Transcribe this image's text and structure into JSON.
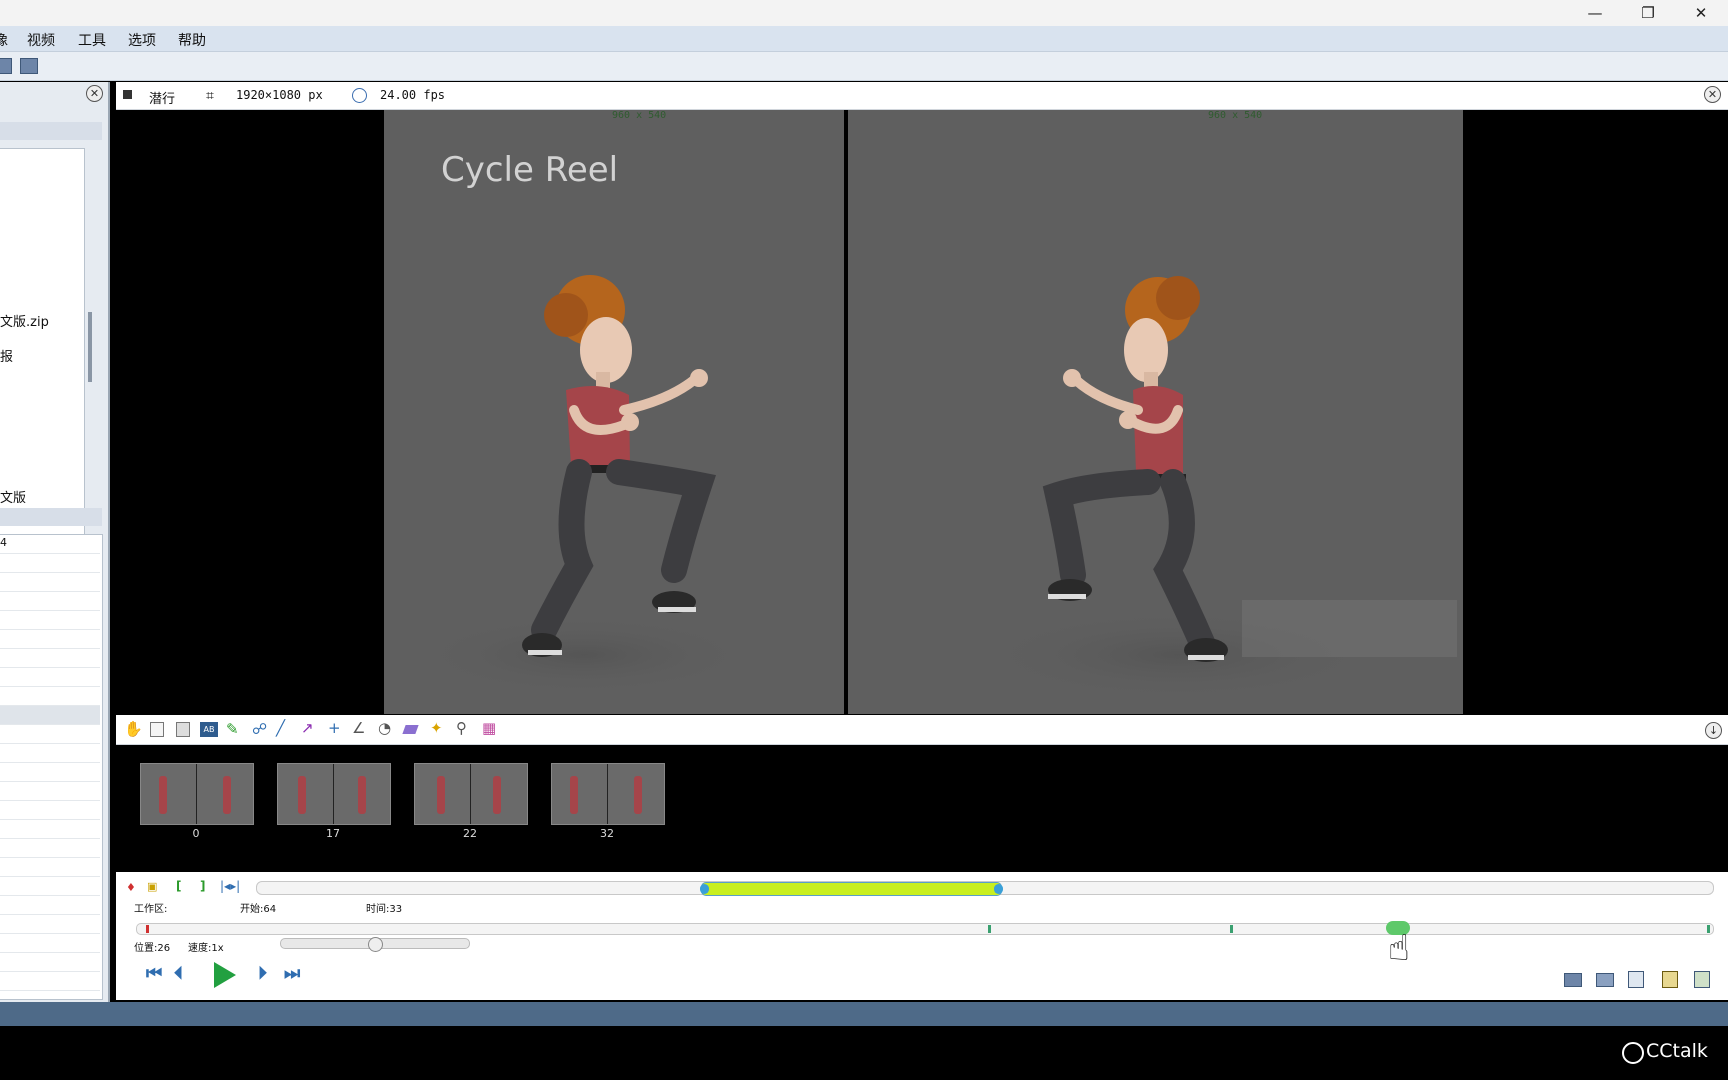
{
  "menu": {
    "items": [
      "像",
      "视频",
      "工具",
      "选项",
      "帮助"
    ]
  },
  "window_controls": {
    "minimize": "—",
    "restore": "❐",
    "close": "✕"
  },
  "left_panel": {
    "files": [
      "文版.zip",
      "报",
      "文版"
    ],
    "list_first": "4"
  },
  "viewer": {
    "title": "潜行",
    "resolution": "1920×1080 px",
    "fps": "24.00 fps",
    "left_frame_res": "960 x 540",
    "right_frame_res": "960 x 540",
    "overlay_text": "Cycle Reel"
  },
  "thumbnails": [
    {
      "label": "0"
    },
    {
      "label": "17"
    },
    {
      "label": "22"
    },
    {
      "label": "32"
    }
  ],
  "timeline": {
    "workspace_label": "工作区:",
    "start_label": "开始:64",
    "time_label": "时间:33",
    "position_label": "位置:26",
    "speed_label": "速度:1x",
    "work_start_fraction": 0.305,
    "work_end_fraction": 0.51,
    "position_fraction": 0.8,
    "speed_slider_fraction": 0.5
  },
  "watermark": "CCtalk",
  "colors": {
    "menu_bg": "#d9e3ef",
    "workzone": "#c8ef1f",
    "playhead": "#5ec96a",
    "play_button": "#22a040"
  }
}
